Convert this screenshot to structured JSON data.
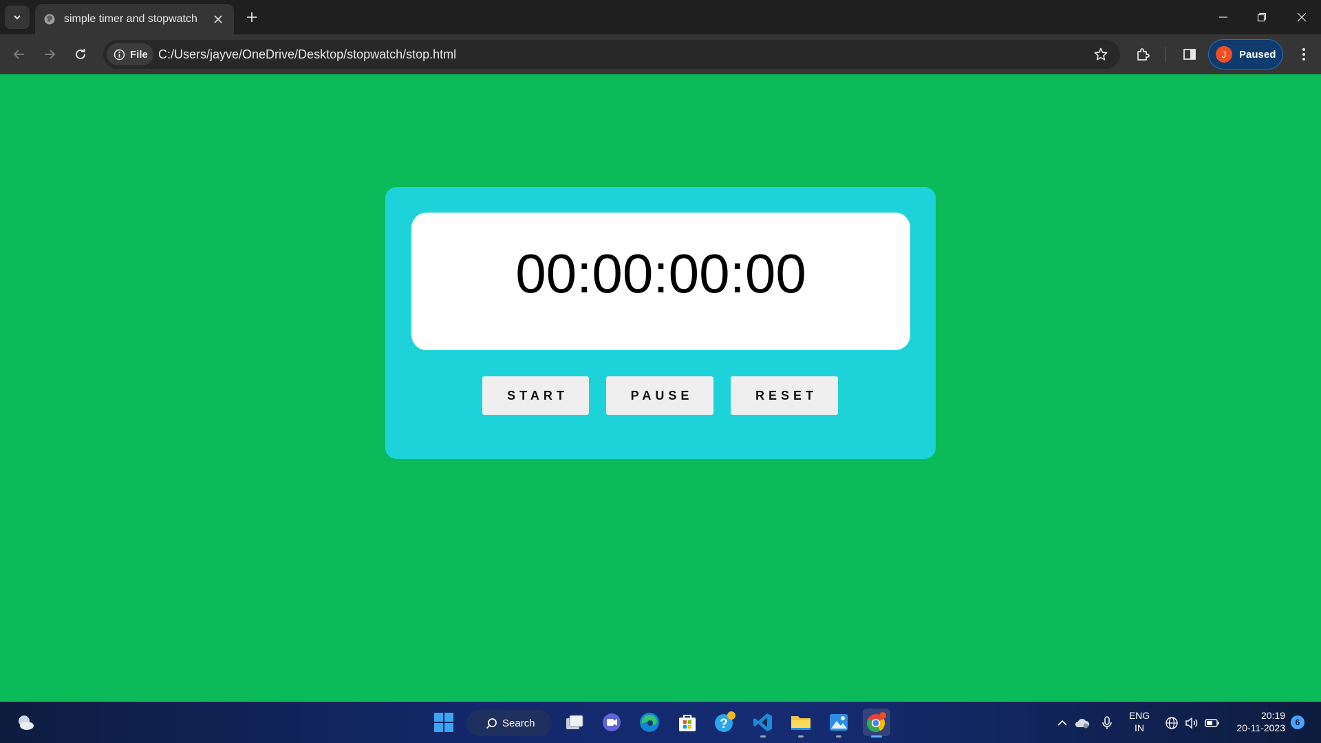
{
  "browser": {
    "tab": {
      "title": "simple timer and stopwatch",
      "favicon": "globe-icon"
    },
    "new_tab_label": "+",
    "omnibox": {
      "chip_label": "File",
      "url": "C:/Users/jayve/OneDrive/Desktop/stopwatch/stop.html"
    },
    "profile": {
      "initial": "J",
      "status": "Paused"
    }
  },
  "stopwatch": {
    "time": "00:00:00:00",
    "buttons": {
      "start": "START",
      "pause": "PAUSE",
      "reset": "RESET"
    }
  },
  "taskbar": {
    "search_label": "Search",
    "language": {
      "line1": "ENG",
      "line2": "IN"
    },
    "clock": {
      "time": "20:19",
      "date": "20-11-2023"
    },
    "notification_count": "6",
    "apps": [
      "start-icon",
      "task-view-icon",
      "meet-icon",
      "edge-icon",
      "store-icon",
      "help-icon",
      "vscode-icon",
      "file-explorer-icon",
      "photos-icon",
      "chrome-icon"
    ]
  },
  "colors": {
    "page_background": "#0bba58",
    "card_background": "#1dd3d9",
    "display_background": "#ffffff",
    "button_background": "#efefef",
    "profile_chip": "#0f3b6f"
  }
}
